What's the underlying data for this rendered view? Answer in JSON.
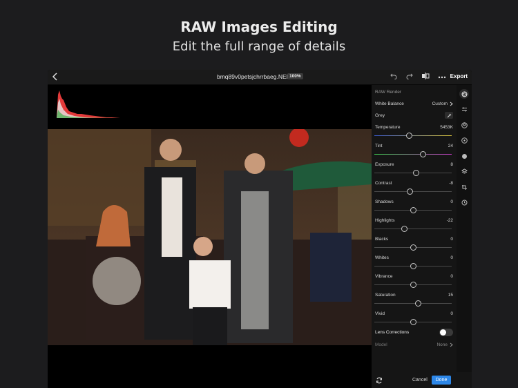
{
  "hero": {
    "title": "RAW Images Editing",
    "subtitle": "Edit the full range of details"
  },
  "topbar": {
    "back_icon": "chevron-left-icon",
    "filename": "bmq89v0petsjchrrbaeg.NEF",
    "zoom": "100%",
    "undo_icon": "undo-icon",
    "redo_icon": "redo-icon",
    "compare_icon": "compare-icon",
    "more_icon": "more-icon",
    "export_label": "Export"
  },
  "panel": {
    "title": "RAW Render",
    "white_balance": {
      "label": "White Balance",
      "value": "Custom"
    },
    "grey": {
      "label": "Grey"
    },
    "sliders": [
      {
        "label": "Temperature",
        "value": "5453K",
        "position": 0.45
      },
      {
        "label": "Tint",
        "value": "24",
        "position": 0.63
      },
      {
        "label": "Exposure",
        "value": "8",
        "position": 0.54
      },
      {
        "label": "Contrast",
        "value": "-8",
        "position": 0.46
      },
      {
        "label": "Shadows",
        "value": "0",
        "position": 0.5
      },
      {
        "label": "Highlights",
        "value": "-22",
        "position": 0.39
      },
      {
        "label": "Blacks",
        "value": "0",
        "position": 0.5
      },
      {
        "label": "Whites",
        "value": "0",
        "position": 0.5
      },
      {
        "label": "Vibrance",
        "value": "0",
        "position": 0.5
      },
      {
        "label": "Saturation",
        "value": "15",
        "position": 0.57
      },
      {
        "label": "Vivid",
        "value": "0",
        "position": 0.5
      }
    ],
    "lens_corrections": {
      "label": "Lens Corrections",
      "enabled": false
    },
    "model": {
      "label": "Model",
      "value": "None"
    }
  },
  "rail_icons": [
    "aperture-icon",
    "sliders-icon",
    "portrait-icon",
    "lens-icon",
    "color-wheel-icon",
    "layers-icon",
    "transform-icon",
    "history-icon"
  ],
  "bottom": {
    "reset_icon": "reset-icon",
    "cancel_label": "Cancel",
    "done_label": "Done"
  },
  "colors": {
    "accent": "#2d87e8",
    "background": "#1c1c1e",
    "panel": "#151515"
  }
}
